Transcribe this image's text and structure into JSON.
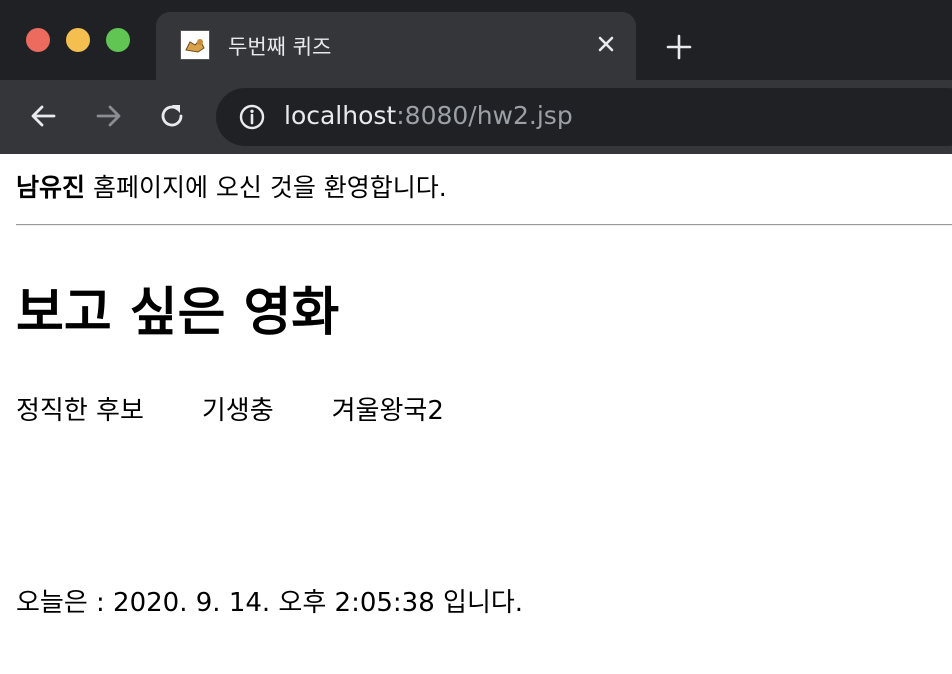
{
  "browser": {
    "tab": {
      "title": "두번째 퀴즈",
      "favicon": "tomcat-icon"
    },
    "address": {
      "host": "localhost",
      "rest": ":8080/hw2.jsp"
    },
    "icons": [
      "back-arrow-icon",
      "forward-arrow-icon",
      "reload-icon",
      "info-icon",
      "close-icon",
      "plus-icon"
    ]
  },
  "page": {
    "welcome_name": "남유진",
    "welcome_text": " 홈페이지에 오신 것을 환영합니다.",
    "heading": "보고 싶은 영화",
    "movies": [
      "정직한 후보",
      "기생충",
      "겨울왕국2"
    ],
    "date_line": "오늘은 : 2020. 9. 14. 오후 2:05:38 입니다."
  }
}
